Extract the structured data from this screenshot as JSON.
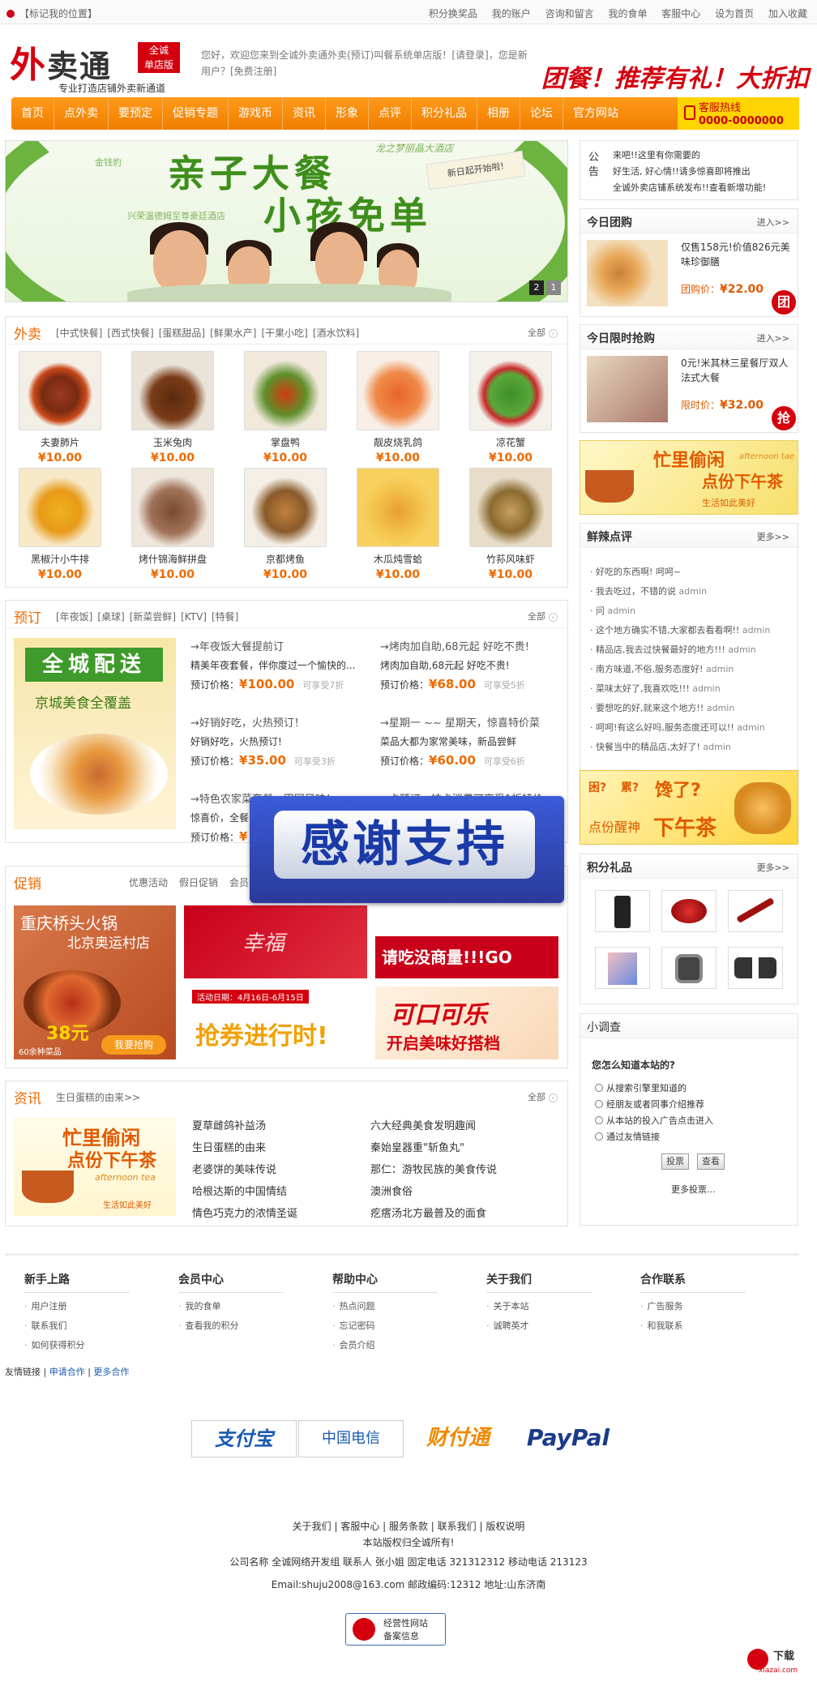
{
  "topbar": {
    "location": "【标记我的位置】",
    "links": [
      "积分换奖品",
      "我的账户",
      "咨询和留言",
      "我的食单",
      "客服中心",
      "设为首页",
      "加入收藏"
    ]
  },
  "header": {
    "logo_big": "外",
    "logo_rest": "卖通",
    "logo_badge_1": "全诚",
    "logo_badge_2": "单店版",
    "logo_sub": "专业打造店铺外卖新通道",
    "welcome": "您好，欢迎您来到全诚外卖通外卖(预订)叫餐系统单店版！[请登录]，您是新用户？[免费注册]",
    "promo": "团餐！推荐有礼！大折扣"
  },
  "nav": {
    "items": [
      "首页",
      "点外卖",
      "要预定",
      "促销专题",
      "游戏币",
      "资讯",
      "形象",
      "点评",
      "积分礼品",
      "相册",
      "论坛",
      "官方网站"
    ],
    "hotline_label": "客服热线",
    "hotline_number": "0000-0000000"
  },
  "banner": {
    "title_1": "亲子大餐",
    "title_2": "小孩免单",
    "hotel": "龙之梦丽晶大酒店",
    "card": "新日起开始啦!",
    "small_1": "金钱豹",
    "small_2": "兴荣温德姆至尊豪廷酒店",
    "pages": [
      "2",
      "1"
    ]
  },
  "takeout": {
    "title": "外卖",
    "cats": [
      "[中式快餐]",
      "[西式快餐]",
      "[蛋糕甜品]",
      "[鲜果水产]",
      "[干果小吃]",
      "[酒水饮料]"
    ],
    "all": "全部",
    "items": [
      {
        "name": "夫妻肺片",
        "price": "¥10.00"
      },
      {
        "name": "玉米兔肉",
        "price": "¥10.00"
      },
      {
        "name": "掌盘鸭",
        "price": "¥10.00"
      },
      {
        "name": "靓皮烧乳鸽",
        "price": "¥10.00"
      },
      {
        "name": "凉花蟹",
        "price": "¥10.00"
      },
      {
        "name": "黑椒汁小牛排",
        "price": "¥10.00"
      },
      {
        "name": "烤什锦海鲜拼盘",
        "price": "¥10.00"
      },
      {
        "name": "京都烤鱼",
        "price": "¥10.00"
      },
      {
        "name": "木瓜炖雪蛤",
        "price": "¥10.00"
      },
      {
        "name": "竹荪风味虾",
        "price": "¥10.00"
      }
    ]
  },
  "reserve": {
    "title": "预订",
    "cats": [
      "[年夜饭]",
      "[桌球]",
      "[新菜尝鲜]",
      "[KTV]",
      "[特餐]"
    ],
    "all": "全部",
    "img_title": "全城配送",
    "img_sub": "京城美食全覆盖",
    "items": [
      {
        "head": "→年夜饭大餐提前订",
        "desc": "精美年夜套餐，伴你度过一个愉快的...",
        "price_label": "预订价格：",
        "price": "¥100.00",
        "disc": "可享受7折"
      },
      {
        "head": "→烤肉加自助,68元起 好吃不贵!",
        "desc": "烤肉加自助,68元起 好吃不贵!",
        "price_label": "预订价格：",
        "price": "¥68.00",
        "disc": "可享受5折"
      },
      {
        "head": "→好销好吃，火热预订！",
        "desc": "好销好吃，火热预订!",
        "price_label": "预订价格：",
        "price": "¥35.00",
        "disc": "可享受3折"
      },
      {
        "head": "→星期一 ~~ 星期天，惊喜特价菜",
        "desc": "菜品大都为家常美味，新品尝鲜",
        "price_label": "预订价格：",
        "price": "¥60.00",
        "disc": "可享受6折"
      },
      {
        "head": "→特色农家菜套餐，田园风味！",
        "desc": "惊喜价，全餐",
        "price_label": "预订价格：",
        "price": "¥",
        "disc": ""
      },
      {
        "head": "→卡预订，持卡消费可享受1折特价",
        "desc": "",
        "price_label": "",
        "price": "",
        "disc": ""
      }
    ]
  },
  "popup": {
    "text": "感谢支持"
  },
  "sales": {
    "title": "促销",
    "tabs": [
      "优惠活动",
      "假日促销",
      "会员"
    ],
    "hotpot_title": "重庆桥头火锅",
    "hotpot_sub": "北京奥运村店",
    "hotpot_price": "38元",
    "hotpot_count": "60余种菜品",
    "hotpot_btn": "我要抢购",
    "b1": "幸福",
    "b2": "请吃没商量!!!GO",
    "b3_date": "活动日期：4月16日-6月15日",
    "b3": "抢券进行时!",
    "b4_1": "可口可乐",
    "b4_2": "开启美味好搭档"
  },
  "news": {
    "title": "资讯",
    "sub": "生日蛋糕的由来>>",
    "all": "全部",
    "img_1": "忙里偷闲",
    "img_2": "点份下午茶",
    "img_3": "afternoon tea",
    "img_4": "生活如此美好",
    "col1": [
      "夏草雌鸽补益汤",
      "生日蛋糕的由来",
      "老婆饼的美味传说",
      "哈根达斯的中国情结",
      "情色巧克力的浓情圣诞"
    ],
    "col2": [
      "六大经典美食发明趣闻",
      "秦始皇器重\"斩鱼丸\"",
      "那仁：游牧民族的美食传说",
      "澳洲食俗",
      "疙瘩汤北方最普及的面食"
    ]
  },
  "notice": {
    "label_1": "公",
    "label_2": "告",
    "lines": [
      "来吧!!这里有你需要的",
      "好生活, 好心情!!请多惊喜即将推出",
      "全诚外卖店铺系统发布!!查看新增功能!"
    ]
  },
  "group": {
    "title": "今日团购",
    "more": "进入>>",
    "desc": "仅售158元!价值826元美味珍御膳",
    "price_label": "团购价：",
    "price": "¥22.00",
    "stamp": "团"
  },
  "flash": {
    "title": "今日限时抢购",
    "more": "进入>>",
    "desc": "0元!米其林三星餐厅双人法式大餐",
    "price_label": "限时价：",
    "price": "¥32.00",
    "stamp": "抢"
  },
  "tea_ad": {
    "l1": "忙里偷闲",
    "l2": "afternoon tae",
    "l3": "点份下午茶",
    "l4": "生活如此美好"
  },
  "comments": {
    "title": "鲜辣点评",
    "more": "更多>>",
    "items": [
      {
        "text": "好吃的东西啊! 呵呵~",
        "user": ""
      },
      {
        "text": "我去吃过，不错的说",
        "user": "admin"
      },
      {
        "text": "问",
        "user": "admin"
      },
      {
        "text": "这个地方确实不错,大家都去看看啊!!",
        "user": "admin"
      },
      {
        "text": "精品店,我去过快餐最好的地方!!!",
        "user": "admin"
      },
      {
        "text": "南方味道,不俗,服务态度好!",
        "user": "admin"
      },
      {
        "text": "菜味太好了,我喜欢吃!!!",
        "user": "admin"
      },
      {
        "text": "要想吃的好,就来这个地方!!",
        "user": "admin"
      },
      {
        "text": "呵呵!有这么好吗,服务态度还可以!!",
        "user": "admin"
      },
      {
        "text": "快餐当中的精品店,太好了!",
        "user": "admin"
      }
    ]
  },
  "tea_ad2": {
    "l1": "困?",
    "l2": "累?",
    "l3": "馋了?",
    "l4": "点份醒神",
    "l5": "下午茶"
  },
  "gifts": {
    "title": "积分礼品",
    "more": "更多>>"
  },
  "survey": {
    "title": "小调查",
    "question": "您怎么知道本站的?",
    "options": [
      "从搜索引擎里知道的",
      "经朋友或者同事介绍推荐",
      "从本站的投入广告点击进入",
      "通过友情链接"
    ],
    "vote": "投票",
    "view": "查看",
    "more": "更多投票..."
  },
  "footer": {
    "cols": [
      {
        "title": "新手上路",
        "items": [
          "用户注册",
          "联系我们",
          "如何获得积分"
        ]
      },
      {
        "title": "会员中心",
        "items": [
          "我的食单",
          "查看我的积分"
        ]
      },
      {
        "title": "帮助中心",
        "items": [
          "热点问题",
          "忘记密码",
          "会员介绍"
        ]
      },
      {
        "title": "关于我们",
        "items": [
          "关于本站",
          "诚聘英才"
        ]
      },
      {
        "title": "合作联系",
        "items": [
          "广告服务",
          "和我联系"
        ]
      }
    ],
    "friend_label": "友情链接",
    "friend_links": [
      "申请合作",
      "更多合作"
    ],
    "pay": [
      "支付宝",
      "中国电信",
      "财付通",
      "PayPal"
    ],
    "bottom_links": "关于我们 | 客服中心 | 服务条款 | 联系我们 | 版权说明",
    "copyright": "本站版权归全诚所有!",
    "company": "公司名称 全诚网络开发组 联系人 张小姐 固定电话 321312312 移动电话 213123",
    "email": "Email:shuju2008@163.com 邮政编码:12312 地址:山东济南",
    "badge_1": "经营性网站",
    "badge_2": "备案信息",
    "watermark": "下载",
    "watermark_url": "xiazai.com"
  },
  "colors": {
    "accent": "#ee6a00",
    "brand_red": "#d4000f",
    "nav": "#f39c12"
  }
}
